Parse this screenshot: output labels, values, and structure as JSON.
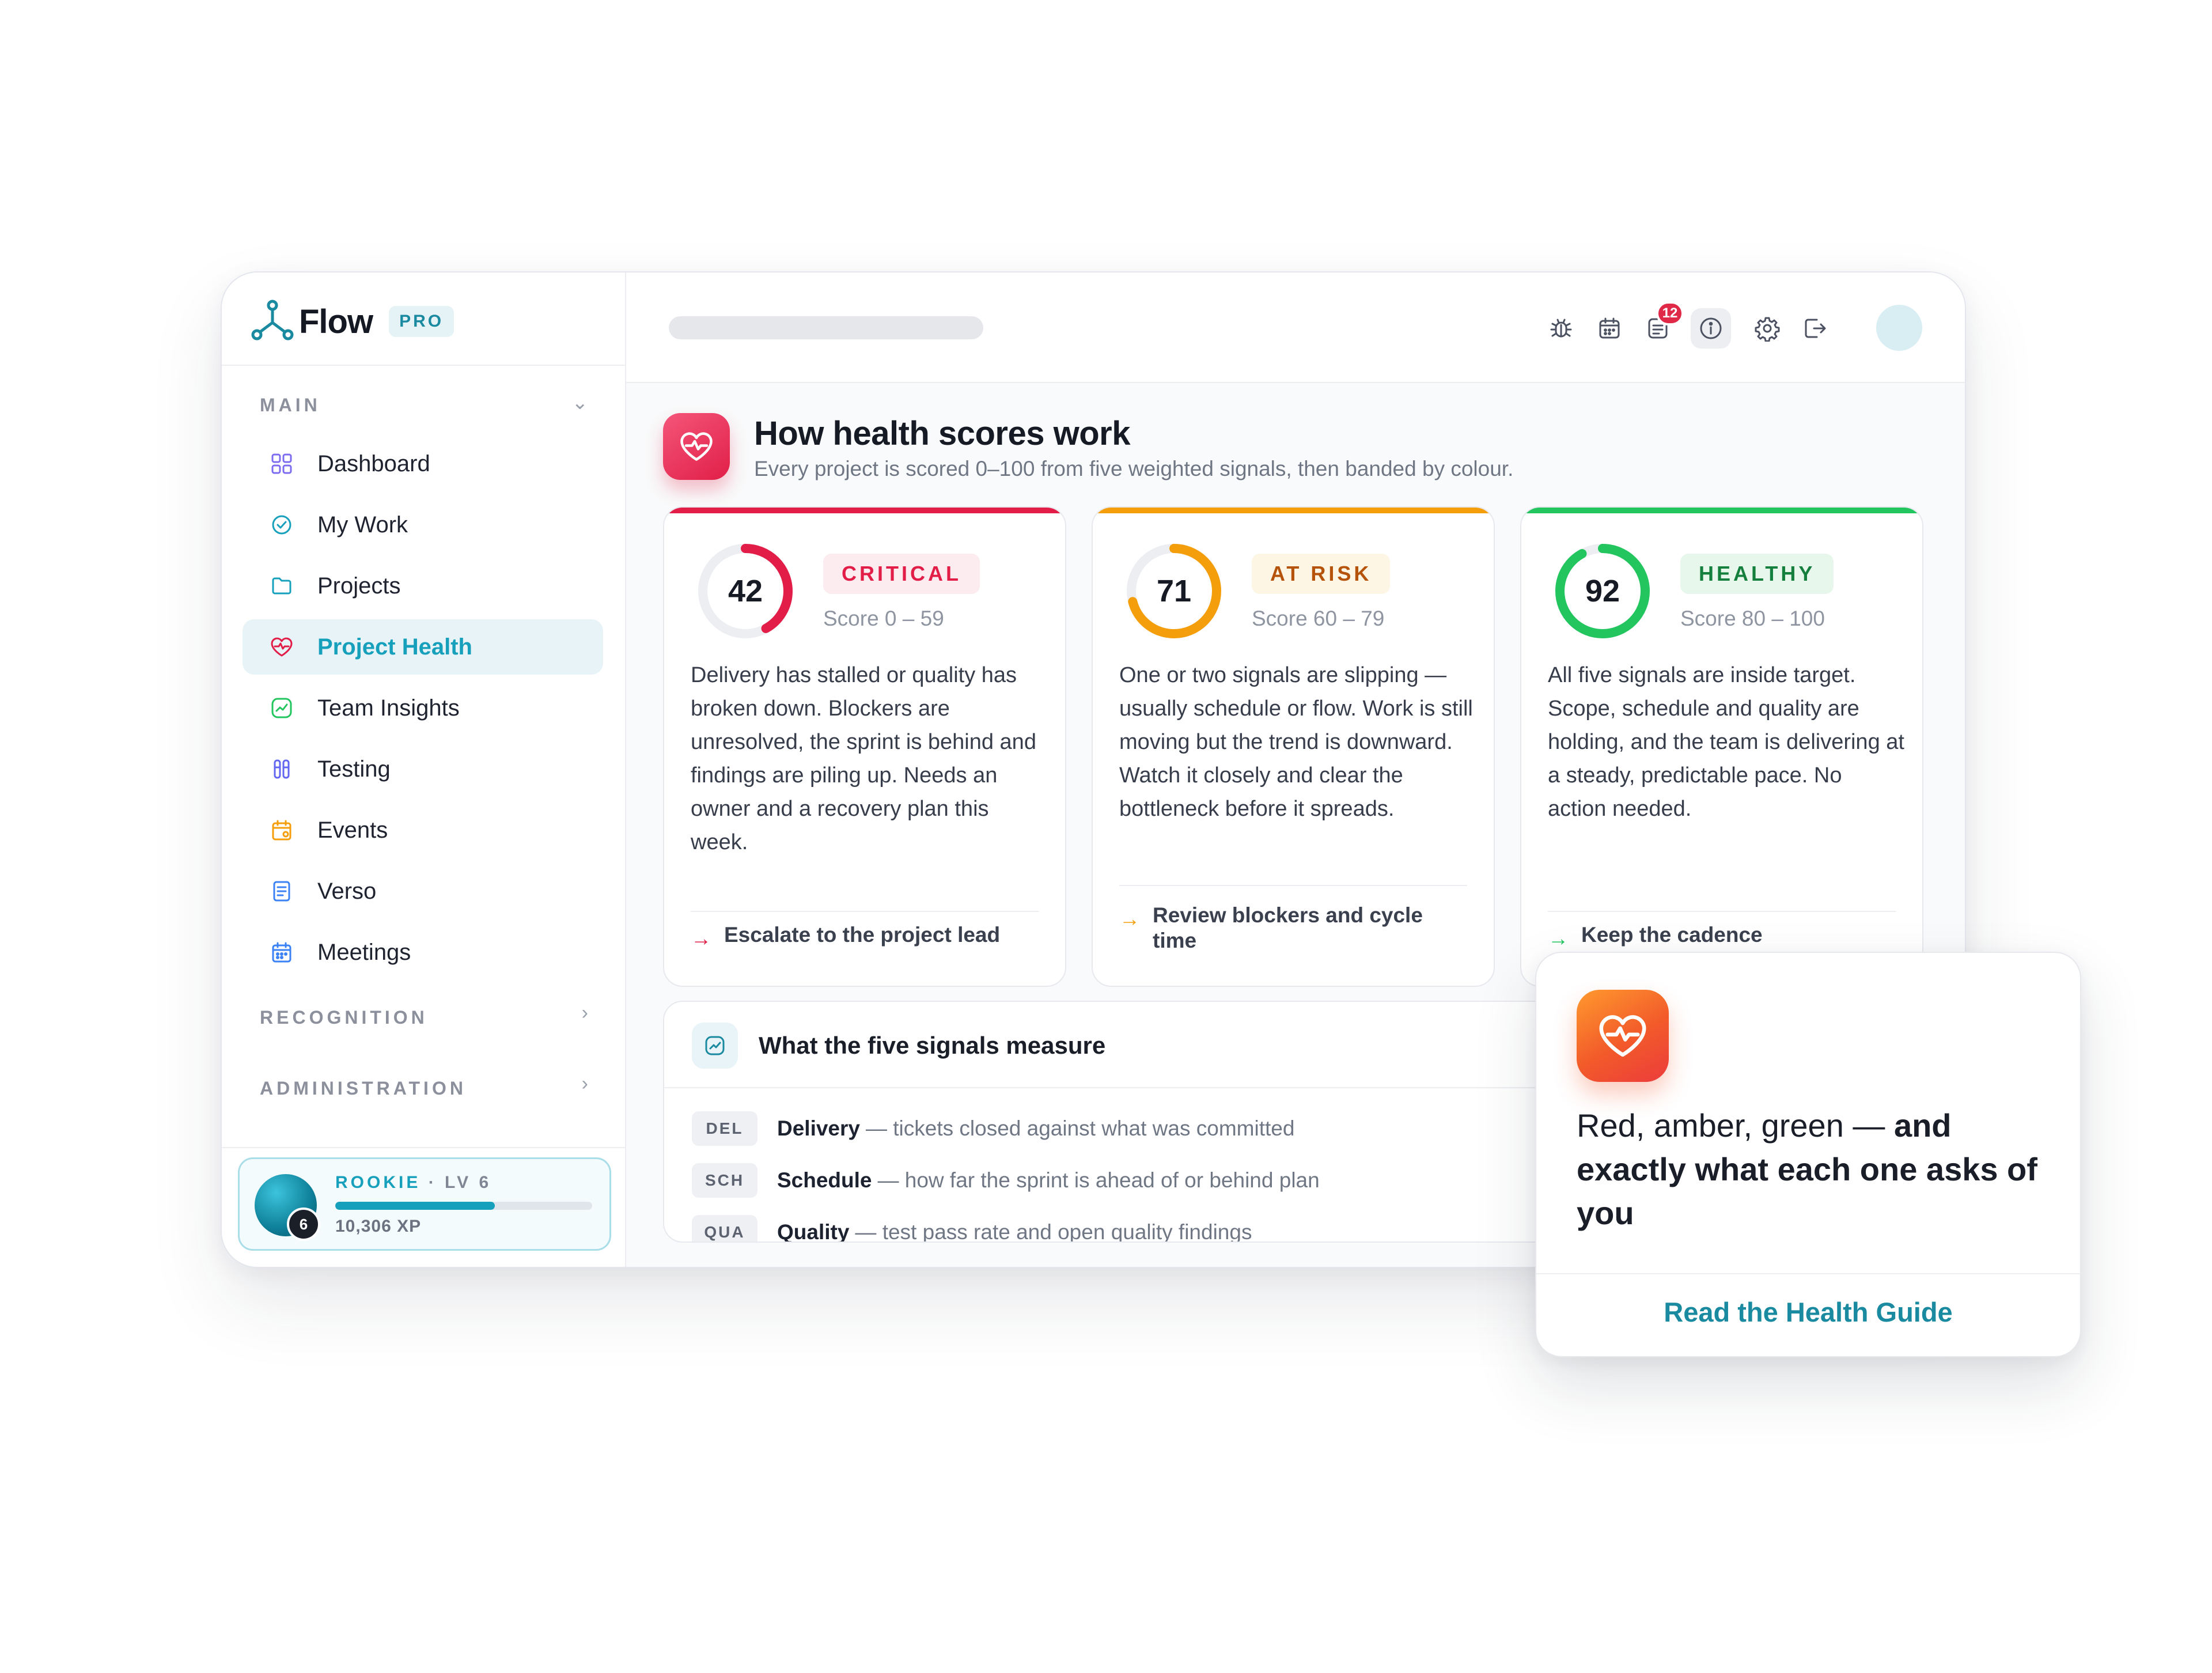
{
  "brand": {
    "name": "Flow",
    "badge": "PRO"
  },
  "sidebar": {
    "sections": {
      "main": "MAIN",
      "recognition": "RECOGNITION",
      "administration": "ADMINISTRATION"
    },
    "items": [
      {
        "label": "Dashboard",
        "icon": "grid-icon"
      },
      {
        "label": "My Work",
        "icon": "check-circle-icon"
      },
      {
        "label": "Projects",
        "icon": "folder-icon"
      },
      {
        "label": "Project Health",
        "icon": "heart-pulse-icon",
        "active": true
      },
      {
        "label": "Team Insights",
        "icon": "trend-icon"
      },
      {
        "label": "Testing",
        "icon": "test-tubes-icon"
      },
      {
        "label": "Events",
        "icon": "calendar-event-icon"
      },
      {
        "label": "Verso",
        "icon": "document-icon"
      },
      {
        "label": "Meetings",
        "icon": "calendar-icon"
      }
    ],
    "xp": {
      "rank": "ROOKIE",
      "level": "· LV 6",
      "level_number": "6",
      "amount": "10,306 XP",
      "progress": 0.62
    }
  },
  "topbar": {
    "notifications": "12"
  },
  "header": {
    "title": "How health scores work",
    "subtitle": "Every project is scored 0–100 from five weighted signals, then banded by colour."
  },
  "cards": [
    {
      "score": "42",
      "score_value": 42,
      "label": "CRITICAL",
      "range": "Score 0 – 59",
      "description": "Delivery has stalled or quality has broken down. Blockers are unresolved, the sprint is behind and findings are piling up. Needs an owner and a recovery plan this week.",
      "action": "Escalate to the project lead",
      "color": "#e11d48",
      "pill_bg": "#fdecef"
    },
    {
      "score": "71",
      "score_value": 71,
      "label": "AT RISK",
      "range": "Score 60 – 79",
      "description": "One or two signals are slipping — usually schedule or flow. Work is still moving but the trend is downward. Watch it closely and clear the bottleneck before it spreads.",
      "action": "Review blockers and cycle time",
      "color": "#f59e0b",
      "pill_bg": "#fef6e4",
      "pill_text": "#b45309"
    },
    {
      "score": "92",
      "score_value": 92,
      "label": "HEALTHY",
      "range": "Score 80 – 100",
      "description": "All five signals are inside target. Scope, schedule and quality are holding, and the team is delivering at a steady, predictable pace. No action needed.",
      "action": "Keep the cadence",
      "color": "#22c55e",
      "pill_bg": "#e7f7ec",
      "pill_text": "#15803d"
    }
  ],
  "signals": {
    "title": "What the five signals measure",
    "rows": [
      {
        "code": "DEL",
        "name": "Delivery",
        "definition": "— tickets closed against what was committed"
      },
      {
        "code": "SCH",
        "name": "Schedule",
        "definition": "— how far the sprint is ahead of or behind plan"
      },
      {
        "code": "QUA",
        "name": "Quality",
        "definition": "— test pass rate and open quality findings"
      }
    ]
  },
  "promo": {
    "lead": "Red, amber, green — ",
    "emphasis": "and exactly what each one asks of you",
    "link": "Read the Health Guide"
  }
}
